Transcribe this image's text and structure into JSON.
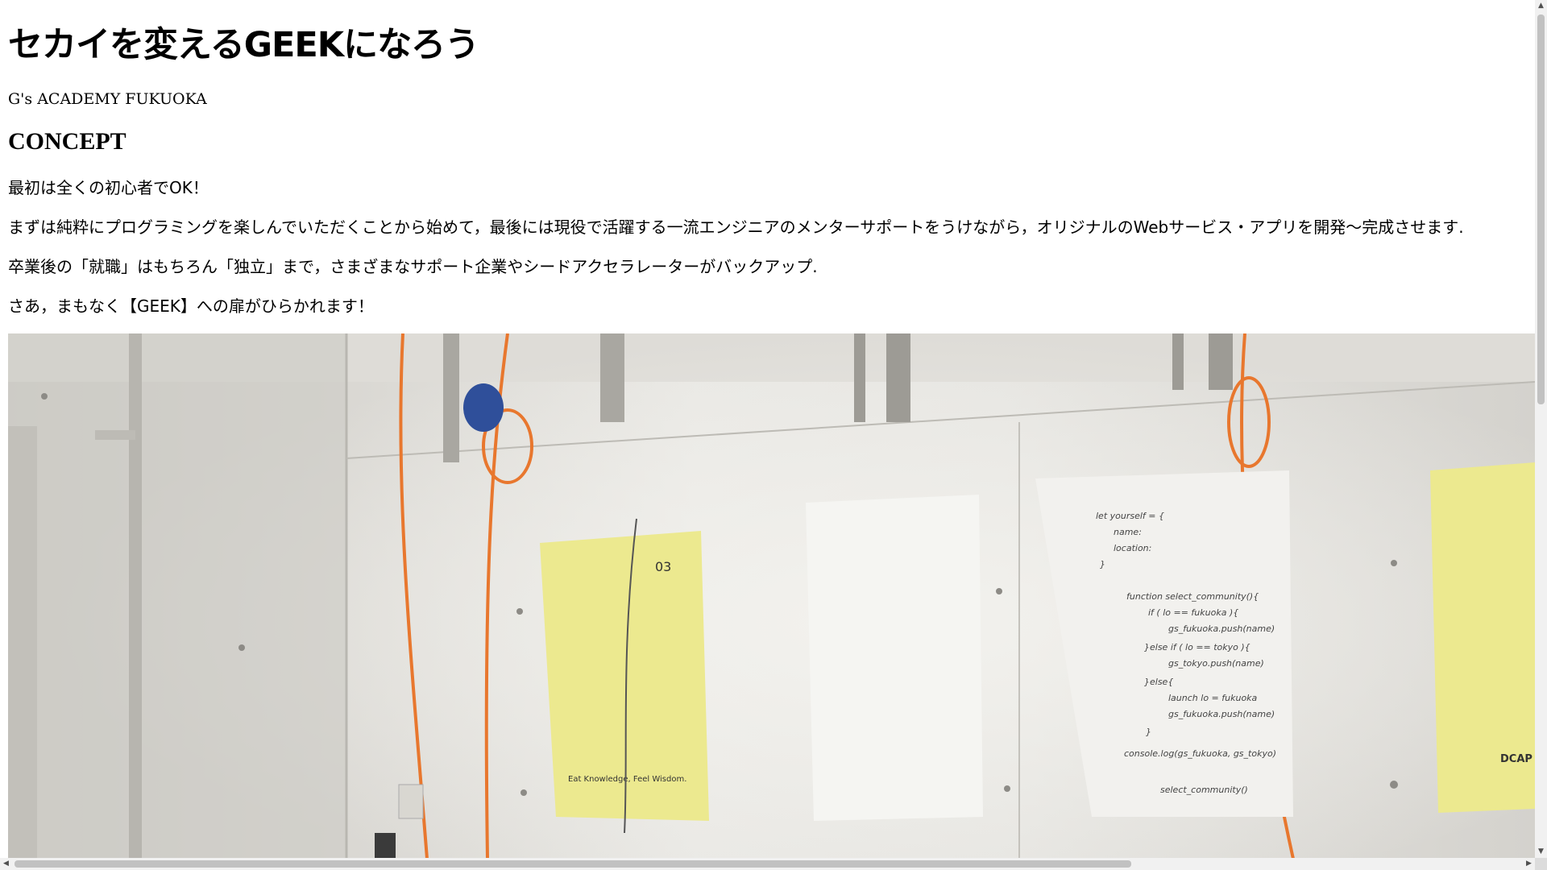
{
  "header": {
    "title": "セカイを変えるGEEKになろう",
    "subtitle": "G's ACADEMY FUKUOKA"
  },
  "concept": {
    "heading": "CONCEPT",
    "paragraphs": [
      "最初は全くの初心者でOK！",
      "まずは純粋にプログラミングを楽しんでいただくことから始めて，最後には現役で活躍する一流エンジニアのメンターサポートをうけながら，オリジナルのWebサービス・アプリを開発〜完成させます.",
      "卒業後の「就職」はもちろん「独立」まで，さまざまなサポート企業やシードアクセラレーターがバックアップ.",
      "さあ，まもなく【GEEK】への扉がひらかれます！"
    ]
  },
  "photo": {
    "poster_caption": "Eat Knowledge, Feel Wisdom.",
    "poster_number": "03",
    "right_poster_caption": "DCAP D",
    "whiteboard_lines": [
      "let yourself = {",
      "name:",
      "location:",
      "}",
      "function select_community(){",
      "if ( lo == fukuoka ){",
      "gs_fukuoka.push(name)",
      "}else if ( lo == tokyo ){",
      "gs_tokyo.push(name)",
      "}else{",
      "launch lo = fukuoka",
      "gs_fukuoka.push(name)",
      "}",
      "console.log(gs_fukuoka, gs_tokyo)",
      "select_community()"
    ]
  },
  "scrollbars": {
    "up_arrow": "▲",
    "down_arrow": "▼",
    "left_arrow": "◀",
    "right_arrow": "▶"
  }
}
